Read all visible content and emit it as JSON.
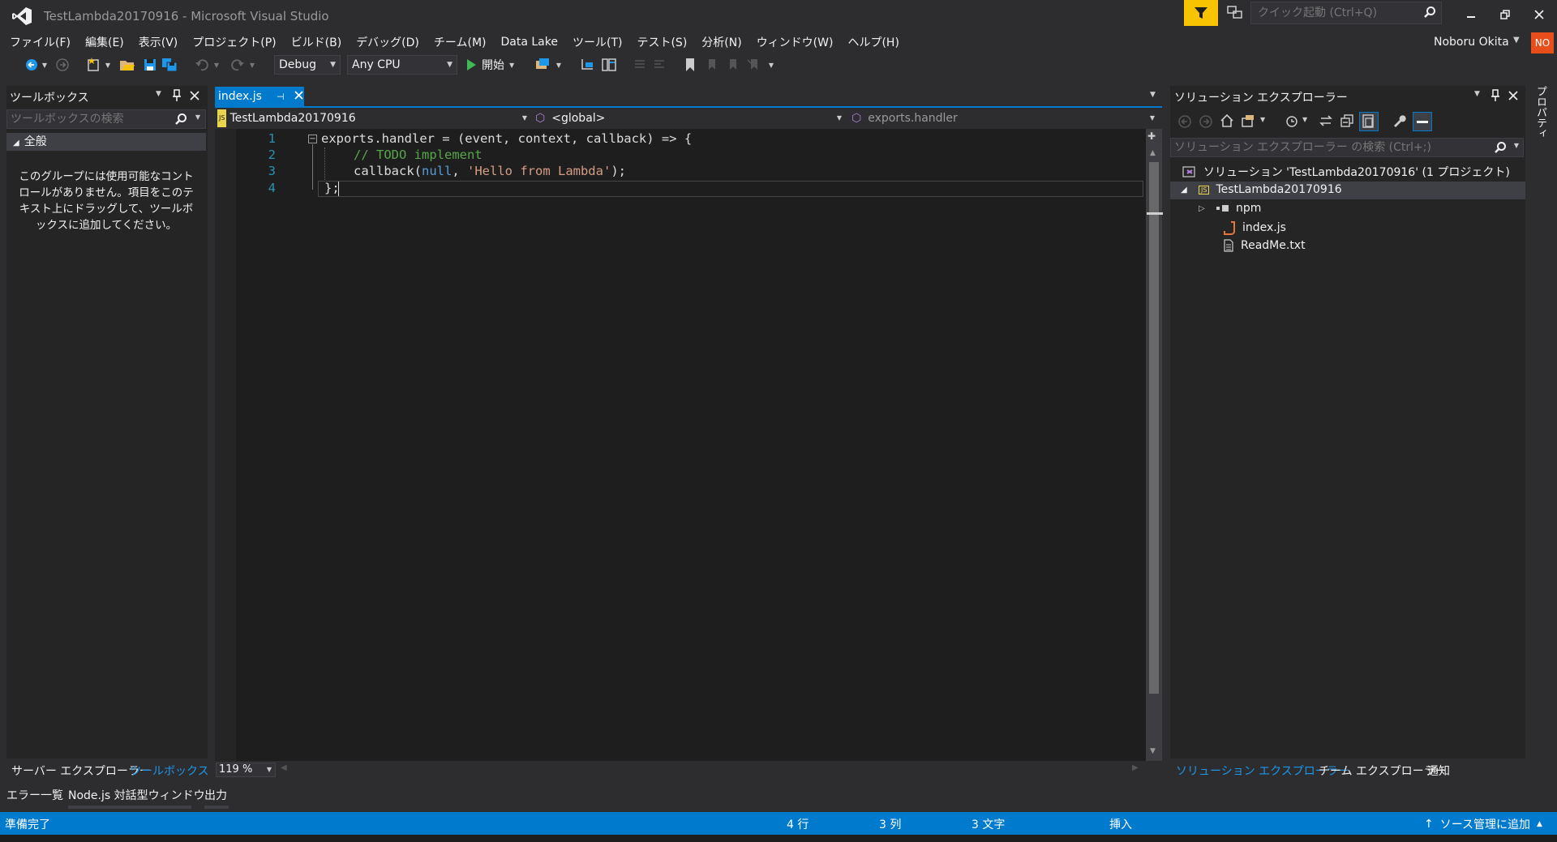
{
  "window": {
    "title": "TestLambda20170916 - Microsoft Visual Studio",
    "quick_launch_placeholder": "クイック起動 (Ctrl+Q)"
  },
  "menu": [
    "ファイル(F)",
    "編集(E)",
    "表示(V)",
    "プロジェクト(P)",
    "ビルド(B)",
    "デバッグ(D)",
    "チーム(M)",
    "Data Lake",
    "ツール(T)",
    "テスト(S)",
    "分析(N)",
    "ウィンドウ(W)",
    "ヘルプ(H)"
  ],
  "user": {
    "name": "Noboru Okita",
    "initials": "NO"
  },
  "toolbar": {
    "config": "Debug",
    "platform": "Any CPU",
    "start_label": "開始"
  },
  "toolbox": {
    "title": "ツールボックス",
    "search_placeholder": "ツールボックスの検索",
    "group": "全般",
    "empty_message": "このグループには使用可能なコントロールがありません。項目をこのテキスト上にドラッグして、ツールボックスに追加してください。",
    "tabs": [
      "サーバー エクスプローラー",
      "ツールボックス"
    ]
  },
  "editor": {
    "tab_label": "index.js",
    "nav": {
      "project": "TestLambda20170916",
      "scope": "<global>",
      "member": "exports.handler"
    },
    "line_numbers": [
      "1",
      "2",
      "3",
      "4"
    ],
    "zoom": "119 %",
    "code": {
      "l1": "exports.handler = (event, context, callback) => {",
      "l2": "// TODO implement",
      "l3a": "callback(",
      "l3b": "null",
      "l3c": ", ",
      "l3d": "'Hello from Lambda'",
      "l3e": ");",
      "l4": "};"
    }
  },
  "solution_explorer": {
    "title": "ソリューション エクスプローラー",
    "search_placeholder": "ソリューション エクスプローラー の検索 (Ctrl+;)",
    "solution": "ソリューション 'TestLambda20170916' (1 プロジェクト)",
    "project": "TestLambda20170916",
    "items": [
      "npm",
      "index.js",
      "ReadMe.txt"
    ],
    "tabs": [
      "ソリューション エクスプローラー",
      "チーム エクスプローラー",
      "通知"
    ]
  },
  "properties_label": "プロパティ",
  "bottom_tabs": [
    "エラー一覧",
    "Node.js 対話型ウィンドウ",
    "出力"
  ],
  "status": {
    "ready": "準備完了",
    "line": "4 行",
    "col": "3 列",
    "chars": "3 文字",
    "mode": "挿入",
    "source_control": "ソース管理に追加"
  },
  "colors": {
    "accent": "#007acc",
    "filter": "#f8c300",
    "badge": "#e84e1b"
  }
}
